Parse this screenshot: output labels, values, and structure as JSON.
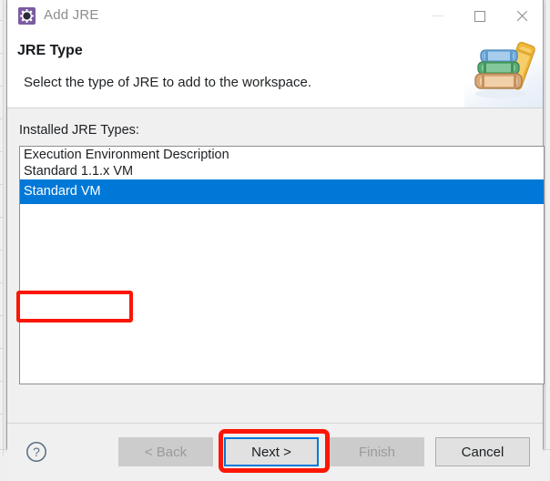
{
  "window": {
    "title": "Add JRE",
    "icon": "jre-gear-icon",
    "controls": {
      "minimize": "minimize-icon",
      "maximize": "maximize-icon",
      "close": "close-icon"
    }
  },
  "header": {
    "title": "JRE Type",
    "description": "Select the type of JRE to add to the workspace.",
    "image": "stack-of-books-icon"
  },
  "main": {
    "list_label": "Installed JRE Types:",
    "items": [
      {
        "label": "Execution Environment Description",
        "selected": false
      },
      {
        "label": "Standard 1.1.x VM",
        "selected": false
      },
      {
        "label": "Standard VM",
        "selected": true
      }
    ],
    "selected_index": 2
  },
  "footer": {
    "help": "help-icon",
    "buttons": [
      {
        "label": "< Back",
        "state": "disabled"
      },
      {
        "label": "Next >",
        "state": "focused"
      },
      {
        "label": "Finish",
        "state": "disabled"
      },
      {
        "label": "Cancel",
        "state": "normal"
      }
    ]
  },
  "annotations": [
    {
      "target": "Standard VM",
      "color": "#fc1605"
    },
    {
      "target": "Next >",
      "color": "#fc1605"
    }
  ],
  "colors": {
    "selection_blue": "#0078d7",
    "annotation_red": "#fc1605",
    "dialog_bg": "#f0f0f0",
    "title_icon_purple": "#7a5ba0"
  }
}
